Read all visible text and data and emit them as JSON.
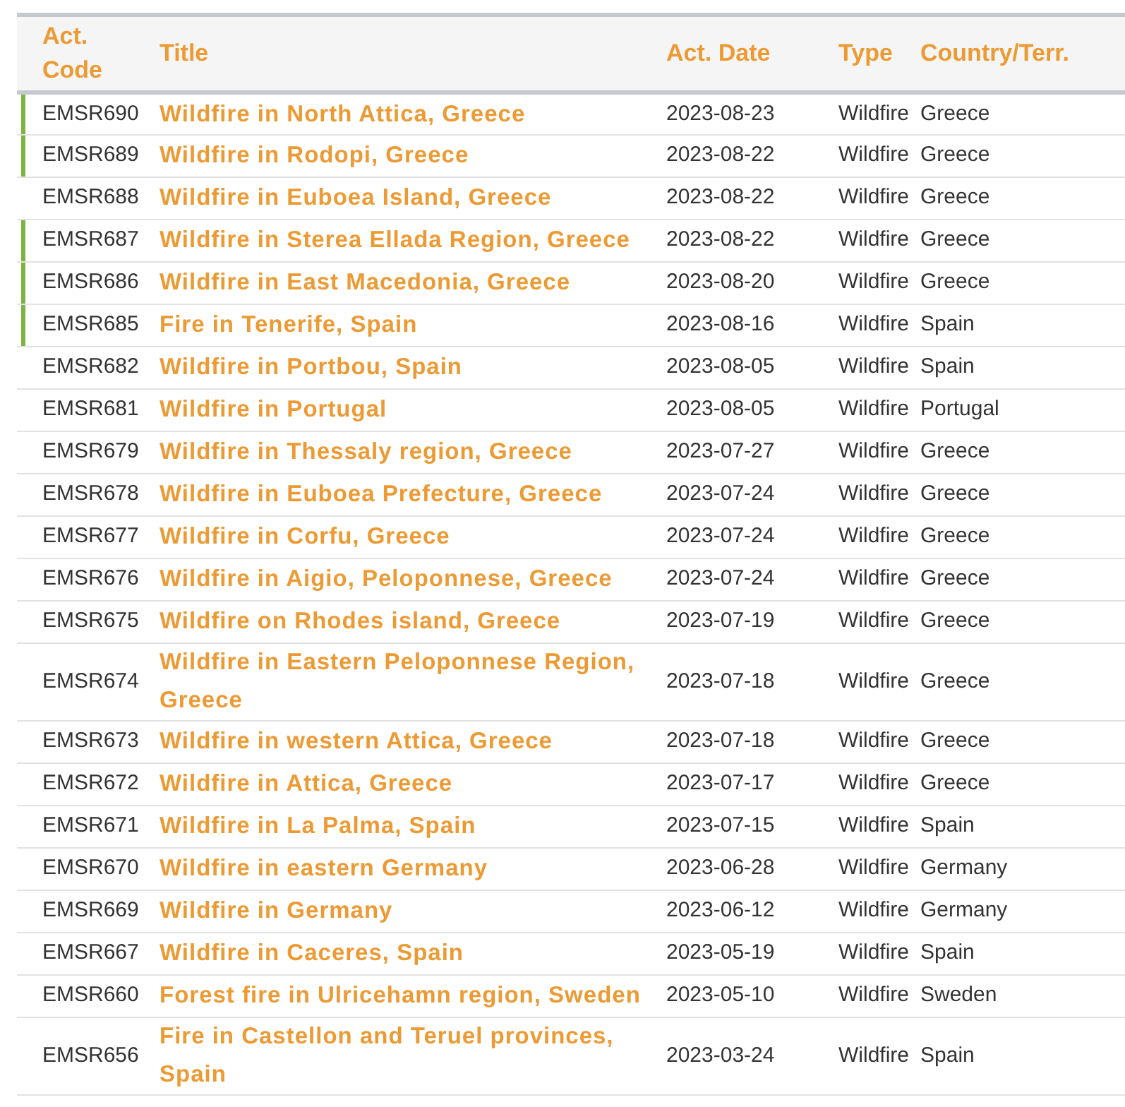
{
  "table": {
    "columns": [
      "Act. Code",
      "Title",
      "Act. Date",
      "Type",
      "Country/Terr."
    ],
    "rows": [
      {
        "code": "EMSR690",
        "title": "Wildfire in North Attica, Greece",
        "date": "2023-08-23",
        "type": "Wildfire",
        "country": "Greece",
        "active": true
      },
      {
        "code": "EMSR689",
        "title": "Wildfire in Rodopi, Greece",
        "date": "2023-08-22",
        "type": "Wildfire",
        "country": "Greece",
        "active": true
      },
      {
        "code": "EMSR688",
        "title": "Wildfire in Euboea Island, Greece",
        "date": "2023-08-22",
        "type": "Wildfire",
        "country": "Greece",
        "active": false
      },
      {
        "code": "EMSR687",
        "title": "Wildfire in Sterea Ellada Region, Greece",
        "date": "2023-08-22",
        "type": "Wildfire",
        "country": "Greece",
        "active": true
      },
      {
        "code": "EMSR686",
        "title": "Wildfire in East Macedonia, Greece",
        "date": "2023-08-20",
        "type": "Wildfire",
        "country": "Greece",
        "active": true
      },
      {
        "code": "EMSR685",
        "title": "Fire in Tenerife, Spain",
        "date": "2023-08-16",
        "type": "Wildfire",
        "country": "Spain",
        "active": true
      },
      {
        "code": "EMSR682",
        "title": "Wildfire in Portbou, Spain",
        "date": "2023-08-05",
        "type": "Wildfire",
        "country": "Spain",
        "active": false
      },
      {
        "code": "EMSR681",
        "title": "Wildfire in Portugal",
        "date": "2023-08-05",
        "type": "Wildfire",
        "country": "Portugal",
        "active": false
      },
      {
        "code": "EMSR679",
        "title": "Wildfire in Thessaly region, Greece",
        "date": "2023-07-27",
        "type": "Wildfire",
        "country": "Greece",
        "active": false
      },
      {
        "code": "EMSR678",
        "title": "Wildfire in Euboea Prefecture, Greece",
        "date": "2023-07-24",
        "type": "Wildfire",
        "country": "Greece",
        "active": false
      },
      {
        "code": "EMSR677",
        "title": "Wildfire in Corfu, Greece",
        "date": "2023-07-24",
        "type": "Wildfire",
        "country": "Greece",
        "active": false
      },
      {
        "code": "EMSR676",
        "title": "Wildfire in Aigio, Peloponnese, Greece",
        "date": "2023-07-24",
        "type": "Wildfire",
        "country": "Greece",
        "active": false
      },
      {
        "code": "EMSR675",
        "title": "Wildfire on Rhodes island, Greece",
        "date": "2023-07-19",
        "type": "Wildfire",
        "country": "Greece",
        "active": false
      },
      {
        "code": "EMSR674",
        "title": "Wildfire in Eastern Peloponnese Region, Greece",
        "date": "2023-07-18",
        "type": "Wildfire",
        "country": "Greece",
        "active": false
      },
      {
        "code": "EMSR673",
        "title": "Wildfire in western Attica, Greece",
        "date": "2023-07-18",
        "type": "Wildfire",
        "country": "Greece",
        "active": false
      },
      {
        "code": "EMSR672",
        "title": "Wildfire in Attica, Greece",
        "date": "2023-07-17",
        "type": "Wildfire",
        "country": "Greece",
        "active": false
      },
      {
        "code": "EMSR671",
        "title": "Wildfire in La Palma, Spain",
        "date": "2023-07-15",
        "type": "Wildfire",
        "country": "Spain",
        "active": false
      },
      {
        "code": "EMSR670",
        "title": "Wildfire in eastern Germany",
        "date": "2023-06-28",
        "type": "Wildfire",
        "country": "Germany",
        "active": false
      },
      {
        "code": "EMSR669",
        "title": "Wildfire in Germany",
        "date": "2023-06-12",
        "type": "Wildfire",
        "country": "Germany",
        "active": false
      },
      {
        "code": "EMSR667",
        "title": "Wildfire in Caceres, Spain",
        "date": "2023-05-19",
        "type": "Wildfire",
        "country": "Spain",
        "active": false
      },
      {
        "code": "EMSR660",
        "title": "Forest fire in Ulricehamn region, Sweden",
        "date": "2023-05-10",
        "type": "Wildfire",
        "country": "Sweden",
        "active": false
      },
      {
        "code": "EMSR656",
        "title": "Fire in Castellon and Teruel provinces, Spain",
        "date": "2023-03-24",
        "type": "Wildfire",
        "country": "Spain",
        "active": false
      }
    ]
  }
}
